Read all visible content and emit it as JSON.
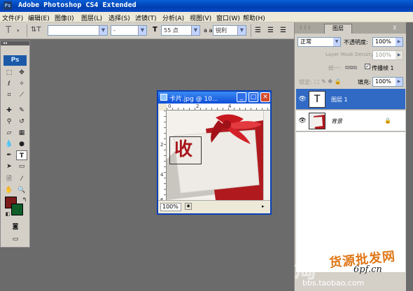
{
  "app": {
    "title": "Adobe Photoshop CS4 Extended"
  },
  "menu": [
    "文件(F)",
    "编辑(E)",
    "图像(I)",
    "图层(L)",
    "选择(S)",
    "滤镜(T)",
    "分析(A)",
    "视图(V)",
    "窗口(W)",
    "帮助(H)"
  ],
  "options": {
    "font_style": "-",
    "size_icon": "T",
    "font_size": "55 点",
    "aa_label": "a a",
    "antialias": "锐利"
  },
  "toolbox": {
    "logo": "Ps"
  },
  "document": {
    "title": "卡片.jpg @ 10...",
    "zoom": "100%",
    "ruler_h": [
      "0",
      "2",
      "4"
    ],
    "ruler_v": [
      "2",
      "4",
      "6"
    ],
    "canvas_text": "收"
  },
  "layers_panel": {
    "tab": "图层",
    "blend_mode": "正常",
    "opacity_label": "不透明度:",
    "opacity": "100%",
    "mask_density_label": "Layer Mask Density",
    "mask_density": "100%",
    "unify_label": "统一:",
    "propagate_label": "传播帧 1",
    "lock_label": "锁定:",
    "fill_label": "填充:",
    "fill": "100%",
    "layers": [
      {
        "name": "图层 1",
        "thumb": "T",
        "selected": true
      },
      {
        "name": "背景",
        "thumb": "",
        "selected": false
      }
    ]
  },
  "watermark": {
    "line1": "货源批发网",
    "line2": "6pf.cn",
    "line3": "bbs.taobao.com",
    "big": "淘"
  }
}
